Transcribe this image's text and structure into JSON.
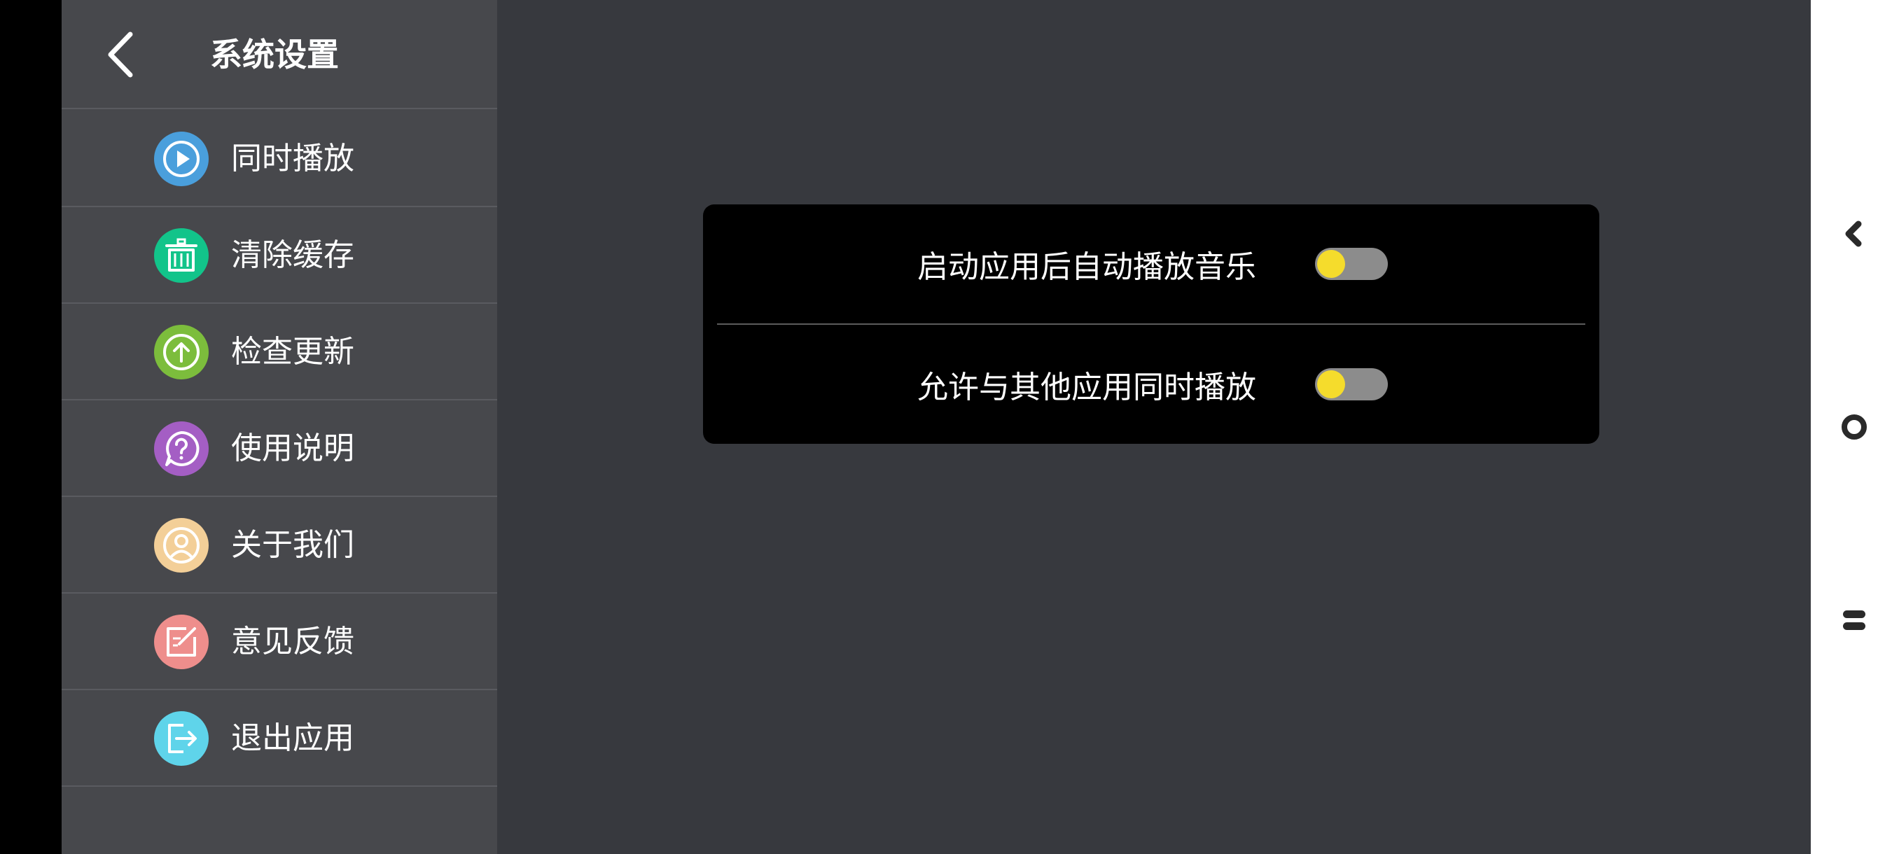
{
  "header": {
    "title": "系统设置",
    "back_icon": "chevron-left-icon"
  },
  "sidebar": {
    "items": [
      {
        "label": "同时播放",
        "icon": "play-icon",
        "color": "#4a9fdc"
      },
      {
        "label": "清除缓存",
        "icon": "trash-icon",
        "color": "#12c48a"
      },
      {
        "label": "检查更新",
        "icon": "upload-arrow-icon",
        "color": "#7cbd3c"
      },
      {
        "label": "使用说明",
        "icon": "help-question-icon",
        "color": "#a45ec4"
      },
      {
        "label": "关于我们",
        "icon": "user-icon",
        "color": "#f3cf98"
      },
      {
        "label": "意见反馈",
        "icon": "edit-feedback-icon",
        "color": "#ee8e8c"
      },
      {
        "label": "退出应用",
        "icon": "exit-icon",
        "color": "#5fd4ea"
      }
    ]
  },
  "settings": [
    {
      "label": "启动应用后自动播放音乐",
      "enabled": false
    },
    {
      "label": "允许与其他应用同时播放",
      "enabled": false
    }
  ],
  "colors": {
    "sidebar_bg": "#47484c",
    "main_bg": "#37393e",
    "card_bg": "#000000",
    "toggle_knob": "#f5dc2c",
    "toggle_track": "#8c8c8c"
  },
  "system_nav": {
    "back_icon": "nav-back-icon",
    "home_icon": "nav-home-icon",
    "recents_icon": "nav-recents-icon"
  }
}
